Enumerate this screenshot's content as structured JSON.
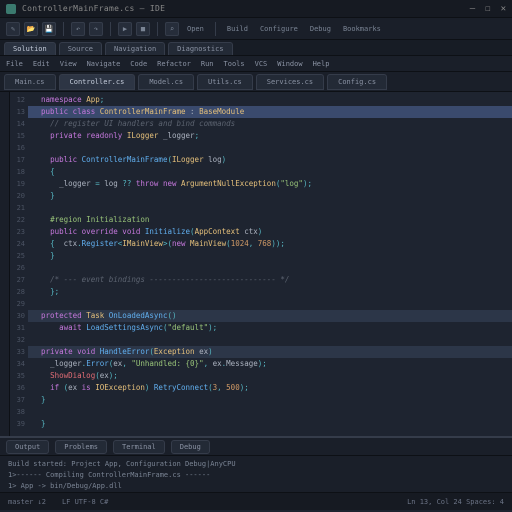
{
  "titlebar": {
    "title": "ControllerMainFrame.cs — IDE"
  },
  "toolbar": {
    "open": "Open",
    "build": "Build",
    "configure": "Configure",
    "debug": "Debug",
    "bookmarks": "Bookmarks"
  },
  "nav_tabs": [
    "Solution",
    "Source",
    "Navigation",
    "Diagnostics"
  ],
  "menu": [
    "File",
    "Edit",
    "View",
    "Navigate",
    "Code",
    "Refactor",
    "Run",
    "Tools",
    "VCS",
    "Window",
    "Help"
  ],
  "file_tabs": [
    {
      "label": "Main.cs",
      "active": false
    },
    {
      "label": "Controller.cs",
      "active": true
    },
    {
      "label": "Model.cs",
      "active": false
    },
    {
      "label": "Utils.cs",
      "active": false
    },
    {
      "label": "Services.cs",
      "active": false
    },
    {
      "label": "Config.cs",
      "active": false
    }
  ],
  "line_start": 12,
  "code": [
    {
      "indent": 1,
      "t": [
        [
          "kw",
          "namespace"
        ],
        [
          "",
          " "
        ],
        [
          "cls",
          "App"
        ],
        [
          "op",
          ";"
        ]
      ]
    },
    {
      "indent": 1,
      "hl": "strong",
      "t": [
        [
          "kw",
          "public class"
        ],
        [
          "",
          " "
        ],
        [
          "cls",
          "ControllerMainFrame"
        ],
        [
          "",
          " : "
        ],
        [
          "cls",
          "BaseModule"
        ]
      ]
    },
    {
      "indent": 2,
      "t": [
        [
          "com",
          "// register UI handlers and bind commands"
        ]
      ]
    },
    {
      "indent": 2,
      "t": [
        [
          "kw",
          "private readonly"
        ],
        [
          "",
          " "
        ],
        [
          "cls",
          "ILogger"
        ],
        [
          "",
          " "
        ],
        [
          "",
          "_logger"
        ],
        [
          "op",
          ";"
        ]
      ]
    },
    {
      "indent": 0,
      "t": []
    },
    {
      "indent": 2,
      "t": [
        [
          "kw",
          "public"
        ],
        [
          "",
          " "
        ],
        [
          "fn",
          "ControllerMainFrame"
        ],
        [
          "op",
          "("
        ],
        [
          "cls",
          "ILogger"
        ],
        [
          "",
          " log"
        ],
        [
          "op",
          ")"
        ]
      ]
    },
    {
      "indent": 2,
      "t": [
        [
          "op",
          "{"
        ]
      ]
    },
    {
      "indent": 3,
      "t": [
        [
          "",
          "_logger "
        ],
        [
          "op",
          "="
        ],
        [
          "",
          " log "
        ],
        [
          "op",
          "??"
        ],
        [
          "",
          " "
        ],
        [
          "kw",
          "throw new"
        ],
        [
          "",
          " "
        ],
        [
          "cls",
          "ArgumentNullException"
        ],
        [
          "op",
          "("
        ],
        [
          "str",
          "\"log\""
        ],
        [
          "op",
          ");"
        ]
      ]
    },
    {
      "indent": 2,
      "t": [
        [
          "op",
          "}"
        ]
      ]
    },
    {
      "indent": 0,
      "t": []
    },
    {
      "indent": 2,
      "t": [
        [
          "str",
          "#region Initialization"
        ]
      ]
    },
    {
      "indent": 2,
      "t": [
        [
          "kw",
          "public override void"
        ],
        [
          "",
          " "
        ],
        [
          "fn",
          "Initialize"
        ],
        [
          "op",
          "("
        ],
        [
          "cls",
          "AppContext"
        ],
        [
          "",
          " ctx"
        ],
        [
          "op",
          ")"
        ]
      ]
    },
    {
      "indent": 2,
      "t": [
        [
          "op",
          "{"
        ],
        [
          "",
          "  "
        ],
        [
          "",
          "ctx"
        ],
        [
          "op",
          "."
        ],
        [
          "fn",
          "Register"
        ],
        [
          "op",
          "<"
        ],
        [
          "cls",
          "IMainView"
        ],
        [
          "op",
          ">("
        ],
        [
          "kw",
          "new"
        ],
        [
          "",
          " "
        ],
        [
          "cls",
          "MainView"
        ],
        [
          "op",
          "("
        ],
        [
          "num",
          "1024"
        ],
        [
          "op",
          ", "
        ],
        [
          "num",
          "768"
        ],
        [
          "op",
          "));"
        ]
      ]
    },
    {
      "indent": 2,
      "t": [
        [
          "op",
          "}"
        ]
      ]
    },
    {
      "indent": 0,
      "t": []
    },
    {
      "indent": 2,
      "t": [
        [
          "com",
          "/* --- event bindings ---------------------------- */"
        ]
      ]
    },
    {
      "indent": 2,
      "t": [
        [
          "op",
          "};"
        ]
      ]
    },
    {
      "indent": 0,
      "t": []
    },
    {
      "indent": 1,
      "hl": "light",
      "t": [
        [
          "kw",
          "protected"
        ],
        [
          "",
          " "
        ],
        [
          "cls",
          "Task"
        ],
        [
          "",
          " "
        ],
        [
          "fn",
          "OnLoadedAsync"
        ],
        [
          "op",
          "()"
        ]
      ]
    },
    {
      "indent": 3,
      "t": [
        [
          "kw",
          "await"
        ],
        [
          "",
          " "
        ],
        [
          "fn",
          "LoadSettingsAsync"
        ],
        [
          "op",
          "("
        ],
        [
          "str",
          "\"default\""
        ],
        [
          "op",
          ");"
        ]
      ]
    },
    {
      "indent": 0,
      "t": []
    },
    {
      "indent": 1,
      "hl": "light",
      "t": [
        [
          "kw",
          "private void"
        ],
        [
          "",
          " "
        ],
        [
          "fn",
          "HandleError"
        ],
        [
          "op",
          "("
        ],
        [
          "cls",
          "Exception"
        ],
        [
          "",
          " ex"
        ],
        [
          "op",
          ")"
        ]
      ]
    },
    {
      "indent": 2,
      "t": [
        [
          "",
          "_logger"
        ],
        [
          "op",
          "."
        ],
        [
          "fn",
          "Error"
        ],
        [
          "op",
          "("
        ],
        [
          "",
          "ex"
        ],
        [
          "op",
          ","
        ],
        [
          "",
          " "
        ],
        [
          "str",
          "\"Unhandled: {0}\""
        ],
        [
          "op",
          ","
        ],
        [
          "",
          " ex"
        ],
        [
          "op",
          "."
        ],
        [
          "",
          "Message"
        ],
        [
          "op",
          ");"
        ]
      ]
    },
    {
      "indent": 2,
      "t": [
        [
          "err",
          "ShowDialog"
        ],
        [
          "op",
          "("
        ],
        [
          "",
          "ex"
        ],
        [
          "op",
          ");"
        ]
      ]
    },
    {
      "indent": 2,
      "t": [
        [
          "kw",
          "if"
        ],
        [
          "op",
          " ("
        ],
        [
          "",
          "ex "
        ],
        [
          "kw",
          "is"
        ],
        [
          "",
          " "
        ],
        [
          "cls",
          "IOException"
        ],
        [
          "op",
          ") "
        ],
        [
          "fn",
          "RetryConnect"
        ],
        [
          "op",
          "("
        ],
        [
          "num",
          "3"
        ],
        [
          "op",
          ", "
        ],
        [
          "num",
          "500"
        ],
        [
          "op",
          ");"
        ]
      ]
    },
    {
      "indent": 1,
      "t": [
        [
          "op",
          "}"
        ]
      ]
    },
    {
      "indent": 0,
      "t": []
    },
    {
      "indent": 1,
      "t": [
        [
          "op",
          "}"
        ]
      ]
    }
  ],
  "bottom": {
    "tabs": [
      "Output",
      "Problems",
      "Terminal",
      "Debug"
    ],
    "lines": [
      "Build started: Project App, Configuration Debug|AnyCPU",
      "1>------ Compiling ControllerMainFrame.cs ------",
      "1>  App -> bin/Debug/App.dll"
    ]
  },
  "status": {
    "left": "master ↓2",
    "mid": "LF  UTF-8  C#",
    "right": "Ln 13, Col 24   Spaces: 4"
  }
}
